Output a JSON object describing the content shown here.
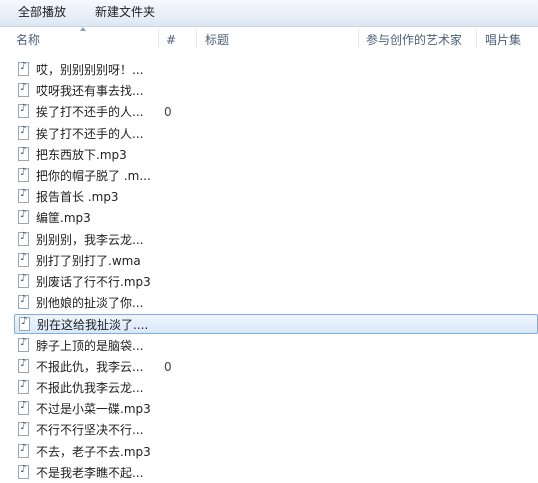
{
  "toolbar": {
    "play_all": "全部播放",
    "new_folder": "新建文件夹"
  },
  "columns": {
    "name": "名称",
    "number": "#",
    "title": "标题",
    "artist": "参与创作的艺术家",
    "album": "唱片集"
  },
  "files": [
    {
      "name": "哎，别别别别呀！...",
      "num": ""
    },
    {
      "name": "哎呀我还有事去找...",
      "num": ""
    },
    {
      "name": "挨了打不还手的人...",
      "num": "0"
    },
    {
      "name": "挨了打不还手的人...",
      "num": ""
    },
    {
      "name": "把东西放下.mp3",
      "num": ""
    },
    {
      "name": "把你的帽子脱了 .m...",
      "num": ""
    },
    {
      "name": "报告首长 .mp3",
      "num": ""
    },
    {
      "name": "编筐.mp3",
      "num": ""
    },
    {
      "name": "别别别，我李云龙...",
      "num": ""
    },
    {
      "name": "别打了别打了.wma",
      "num": ""
    },
    {
      "name": "别废话了行不行.mp3",
      "num": ""
    },
    {
      "name": "别他娘的扯淡了你...",
      "num": ""
    },
    {
      "name": "别在这给我扯淡了....",
      "num": "",
      "selected": true
    },
    {
      "name": "脖子上顶的是脑袋...",
      "num": ""
    },
    {
      "name": "不报此仇，我李云...",
      "num": "0"
    },
    {
      "name": "不报此仇我李云龙...",
      "num": ""
    },
    {
      "name": "不过是小菜一碟.mp3",
      "num": ""
    },
    {
      "name": "不行不行坚决不行...",
      "num": ""
    },
    {
      "name": "不去，老子不去.mp3",
      "num": ""
    },
    {
      "name": "不是我老李瞧不起...",
      "num": ""
    }
  ]
}
